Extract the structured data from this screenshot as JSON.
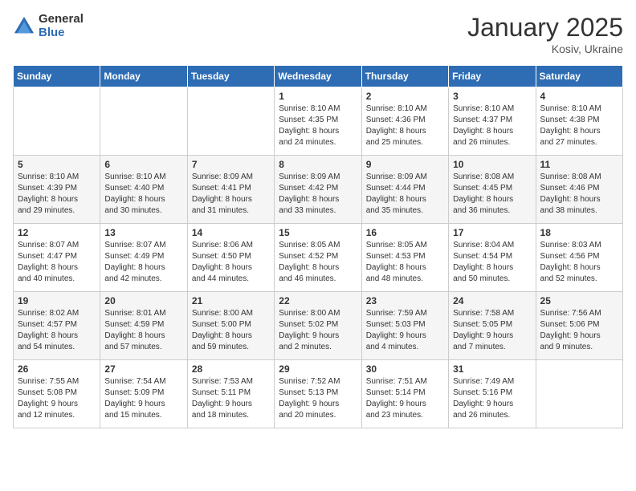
{
  "logo": {
    "general": "General",
    "blue": "Blue"
  },
  "title": "January 2025",
  "location": "Kosiv, Ukraine",
  "days_of_week": [
    "Sunday",
    "Monday",
    "Tuesday",
    "Wednesday",
    "Thursday",
    "Friday",
    "Saturday"
  ],
  "weeks": [
    [
      {
        "day": "",
        "info": ""
      },
      {
        "day": "",
        "info": ""
      },
      {
        "day": "",
        "info": ""
      },
      {
        "day": "1",
        "info": "Sunrise: 8:10 AM\nSunset: 4:35 PM\nDaylight: 8 hours\nand 24 minutes."
      },
      {
        "day": "2",
        "info": "Sunrise: 8:10 AM\nSunset: 4:36 PM\nDaylight: 8 hours\nand 25 minutes."
      },
      {
        "day": "3",
        "info": "Sunrise: 8:10 AM\nSunset: 4:37 PM\nDaylight: 8 hours\nand 26 minutes."
      },
      {
        "day": "4",
        "info": "Sunrise: 8:10 AM\nSunset: 4:38 PM\nDaylight: 8 hours\nand 27 minutes."
      }
    ],
    [
      {
        "day": "5",
        "info": "Sunrise: 8:10 AM\nSunset: 4:39 PM\nDaylight: 8 hours\nand 29 minutes."
      },
      {
        "day": "6",
        "info": "Sunrise: 8:10 AM\nSunset: 4:40 PM\nDaylight: 8 hours\nand 30 minutes."
      },
      {
        "day": "7",
        "info": "Sunrise: 8:09 AM\nSunset: 4:41 PM\nDaylight: 8 hours\nand 31 minutes."
      },
      {
        "day": "8",
        "info": "Sunrise: 8:09 AM\nSunset: 4:42 PM\nDaylight: 8 hours\nand 33 minutes."
      },
      {
        "day": "9",
        "info": "Sunrise: 8:09 AM\nSunset: 4:44 PM\nDaylight: 8 hours\nand 35 minutes."
      },
      {
        "day": "10",
        "info": "Sunrise: 8:08 AM\nSunset: 4:45 PM\nDaylight: 8 hours\nand 36 minutes."
      },
      {
        "day": "11",
        "info": "Sunrise: 8:08 AM\nSunset: 4:46 PM\nDaylight: 8 hours\nand 38 minutes."
      }
    ],
    [
      {
        "day": "12",
        "info": "Sunrise: 8:07 AM\nSunset: 4:47 PM\nDaylight: 8 hours\nand 40 minutes."
      },
      {
        "day": "13",
        "info": "Sunrise: 8:07 AM\nSunset: 4:49 PM\nDaylight: 8 hours\nand 42 minutes."
      },
      {
        "day": "14",
        "info": "Sunrise: 8:06 AM\nSunset: 4:50 PM\nDaylight: 8 hours\nand 44 minutes."
      },
      {
        "day": "15",
        "info": "Sunrise: 8:05 AM\nSunset: 4:52 PM\nDaylight: 8 hours\nand 46 minutes."
      },
      {
        "day": "16",
        "info": "Sunrise: 8:05 AM\nSunset: 4:53 PM\nDaylight: 8 hours\nand 48 minutes."
      },
      {
        "day": "17",
        "info": "Sunrise: 8:04 AM\nSunset: 4:54 PM\nDaylight: 8 hours\nand 50 minutes."
      },
      {
        "day": "18",
        "info": "Sunrise: 8:03 AM\nSunset: 4:56 PM\nDaylight: 8 hours\nand 52 minutes."
      }
    ],
    [
      {
        "day": "19",
        "info": "Sunrise: 8:02 AM\nSunset: 4:57 PM\nDaylight: 8 hours\nand 54 minutes."
      },
      {
        "day": "20",
        "info": "Sunrise: 8:01 AM\nSunset: 4:59 PM\nDaylight: 8 hours\nand 57 minutes."
      },
      {
        "day": "21",
        "info": "Sunrise: 8:00 AM\nSunset: 5:00 PM\nDaylight: 8 hours\nand 59 minutes."
      },
      {
        "day": "22",
        "info": "Sunrise: 8:00 AM\nSunset: 5:02 PM\nDaylight: 9 hours\nand 2 minutes."
      },
      {
        "day": "23",
        "info": "Sunrise: 7:59 AM\nSunset: 5:03 PM\nDaylight: 9 hours\nand 4 minutes."
      },
      {
        "day": "24",
        "info": "Sunrise: 7:58 AM\nSunset: 5:05 PM\nDaylight: 9 hours\nand 7 minutes."
      },
      {
        "day": "25",
        "info": "Sunrise: 7:56 AM\nSunset: 5:06 PM\nDaylight: 9 hours\nand 9 minutes."
      }
    ],
    [
      {
        "day": "26",
        "info": "Sunrise: 7:55 AM\nSunset: 5:08 PM\nDaylight: 9 hours\nand 12 minutes."
      },
      {
        "day": "27",
        "info": "Sunrise: 7:54 AM\nSunset: 5:09 PM\nDaylight: 9 hours\nand 15 minutes."
      },
      {
        "day": "28",
        "info": "Sunrise: 7:53 AM\nSunset: 5:11 PM\nDaylight: 9 hours\nand 18 minutes."
      },
      {
        "day": "29",
        "info": "Sunrise: 7:52 AM\nSunset: 5:13 PM\nDaylight: 9 hours\nand 20 minutes."
      },
      {
        "day": "30",
        "info": "Sunrise: 7:51 AM\nSunset: 5:14 PM\nDaylight: 9 hours\nand 23 minutes."
      },
      {
        "day": "31",
        "info": "Sunrise: 7:49 AM\nSunset: 5:16 PM\nDaylight: 9 hours\nand 26 minutes."
      },
      {
        "day": "",
        "info": ""
      }
    ]
  ]
}
